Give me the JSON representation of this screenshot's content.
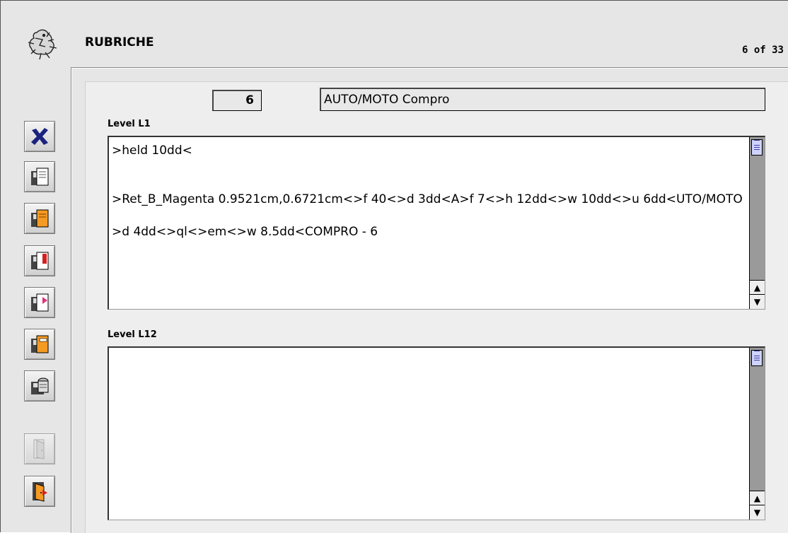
{
  "header": {
    "title": "RUBRICHE",
    "record_counter": "6 of 33"
  },
  "record": {
    "number": "6",
    "name": "AUTO/MOTO Compro"
  },
  "fields": {
    "level_l1": {
      "label": "Level L1",
      "content": ">held 10dd<\n\n\n>Ret_B_Magenta 0.9521cm,0.6721cm<>f 40<>d 3dd<A>f 7<>h 12dd<>w 10dd<>u 6dd<UTO/MOTO\n\n>d 4dd<>ql<>em<>w 8.5dd<COMPRO - 6"
    },
    "level_l12": {
      "label": "Level L12",
      "content": ""
    }
  },
  "toolbar": {
    "buttons": [
      {
        "icon": "delete-x-icon"
      },
      {
        "icon": "disk-save-icon"
      },
      {
        "icon": "disk-orange-icon"
      },
      {
        "icon": "disk-red-icon"
      },
      {
        "icon": "disk-pink-icon"
      },
      {
        "icon": "disk-orange-2-icon"
      },
      {
        "icon": "disk-print-icon"
      },
      {
        "icon": "door-disabled-icon"
      },
      {
        "icon": "door-exit-icon"
      }
    ]
  },
  "colors": {
    "background": "#e6e6e6",
    "scroll_thumb": "#cfd3ff",
    "delete_icon": "#1a237e"
  }
}
